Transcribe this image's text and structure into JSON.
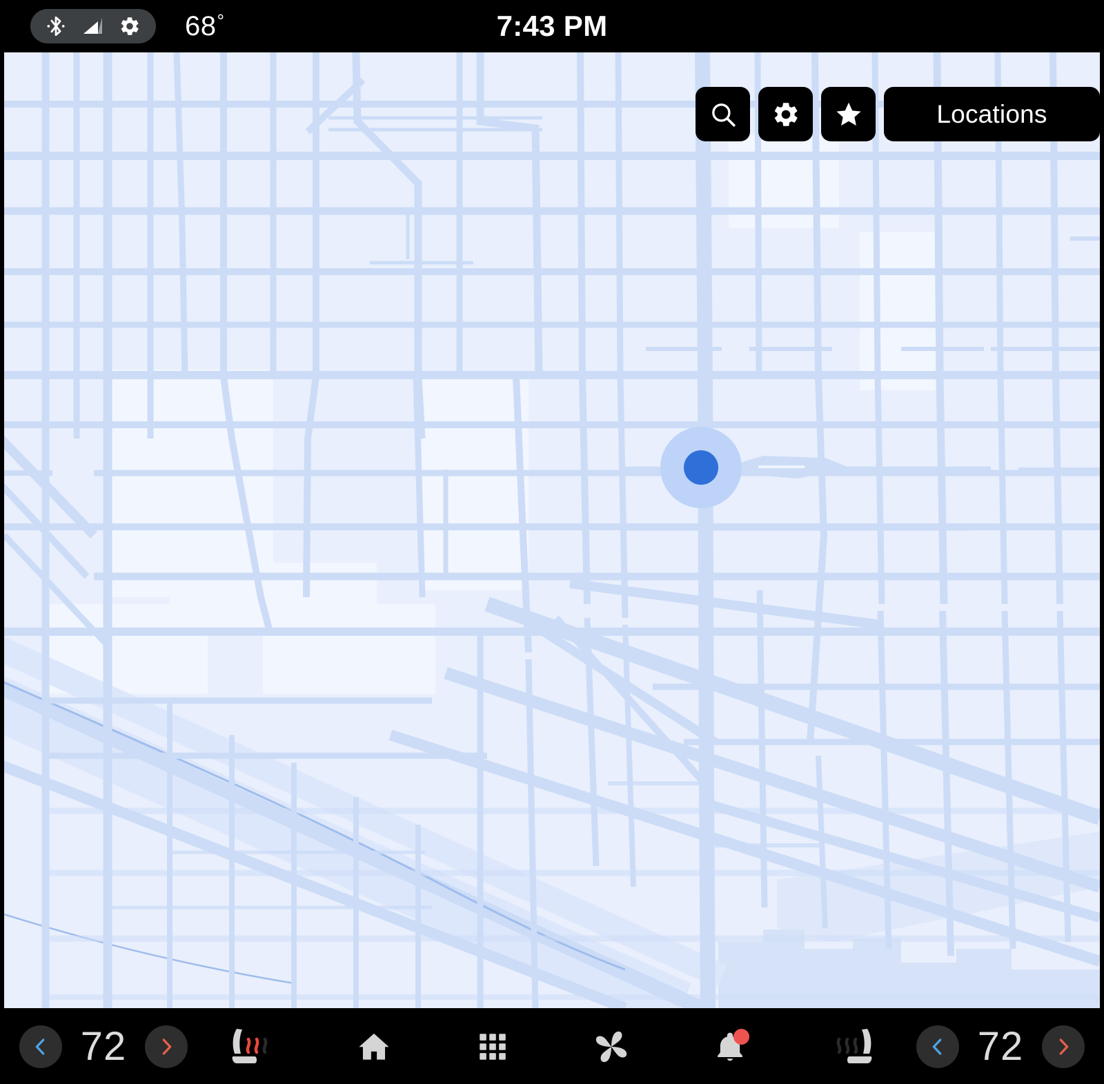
{
  "status_bar": {
    "icons": [
      {
        "name": "bluetooth-icon",
        "label": "Bluetooth"
      },
      {
        "name": "signal-icon",
        "label": "Cellular signal"
      },
      {
        "name": "gear-icon",
        "label": "Settings"
      }
    ],
    "outside_temperature": "68",
    "degree_symbol": "°",
    "clock": "7:43 PM"
  },
  "map": {
    "background_color": "#e9effc",
    "road_color": "#ccdcf7",
    "water_color": "#d6e2f7",
    "marker": {
      "name": "current-location-marker",
      "dot_color": "#2f6fd8",
      "halo_color": "#bdd4f8"
    },
    "toolbar": [
      {
        "name": "search-button",
        "icon": "search-icon",
        "label": ""
      },
      {
        "name": "map-settings-button",
        "icon": "gear-icon",
        "label": ""
      },
      {
        "name": "favorites-button",
        "icon": "star-icon",
        "label": ""
      },
      {
        "name": "locations-button",
        "icon": "",
        "label": "Locations"
      }
    ]
  },
  "nav_bar": {
    "climate_left": {
      "decrease_label": "‹",
      "temperature": "72",
      "increase_label": "›",
      "seat_heater": {
        "name": "driver-seat-heater-button",
        "state": "on",
        "active_color": "#e8493c",
        "inactive_color": "#2b2b2b"
      }
    },
    "climate_right": {
      "decrease_label": "‹",
      "temperature": "72",
      "increase_label": "›",
      "seat_heater": {
        "name": "passenger-seat-heater-button",
        "state": "off",
        "active_color": "#2b2b2b",
        "inactive_color": "#2b2b2b"
      }
    },
    "center_items": [
      {
        "name": "home-button",
        "icon": "home-icon"
      },
      {
        "name": "apps-button",
        "icon": "grid-icon"
      },
      {
        "name": "climate-button",
        "icon": "fan-icon"
      },
      {
        "name": "notifications-button",
        "icon": "bell-icon",
        "badge": true
      }
    ],
    "colors": {
      "chevron_decrease": "#4fa3e3",
      "chevron_increase": "#e8604c",
      "icon": "#d5d5d5",
      "badge": "#ef5350",
      "button_bg": "#2e2e2e"
    }
  }
}
